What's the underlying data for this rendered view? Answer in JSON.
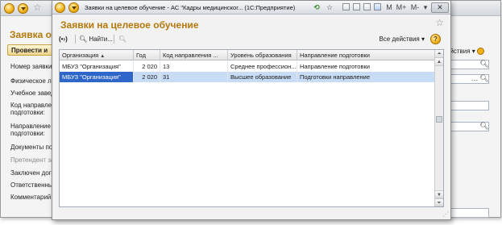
{
  "background_window": {
    "title": "Заявка о",
    "post_button": "Провести и",
    "all_actions": "йствия",
    "labels": [
      {
        "text": "Номер заявки:"
      },
      {
        "text": "Физическое ли"
      },
      {
        "text": "Учебное заведе"
      },
      {
        "text": "Код направлени"
      },
      {
        "text": "подготовки:"
      },
      {
        "text": "Направление"
      },
      {
        "text": "подготовки:"
      },
      {
        "text": "Документы под"
      },
      {
        "text": "Претендент зач"
      },
      {
        "text": "Заключен догов"
      },
      {
        "text": "Ответственный"
      },
      {
        "text": "Комментарий:"
      }
    ]
  },
  "window": {
    "title": "Заявки на целевое обучение - АС \"Кадры медицинског...  (1С:Предприятие)",
    "heading": "Заявки на целевое обучение",
    "titlebar_buttons": {
      "m": "M",
      "mplus": "M+",
      "mminus": "M-"
    }
  },
  "toolbar": {
    "find_label": "Найти...",
    "all_actions_label": "Все действия",
    "help_label": "?"
  },
  "table": {
    "columns": [
      "Организация",
      "Год",
      "Код направления ...",
      "Уровень образования",
      "Направление подготовки"
    ],
    "rows": [
      [
        "МБУЗ \"Организация\"",
        "2 020",
        "13",
        "Среднее профессион...",
        "Направление подготовки"
      ],
      [
        "МБУЗ \"Организация\"",
        "2 020",
        "31",
        "Высшее образование",
        "Подготовки направление"
      ]
    ]
  },
  "colors": {
    "accent_title": "#b5780a",
    "selection": "#c9dcf5",
    "focus_cell": "#2f66c9"
  }
}
